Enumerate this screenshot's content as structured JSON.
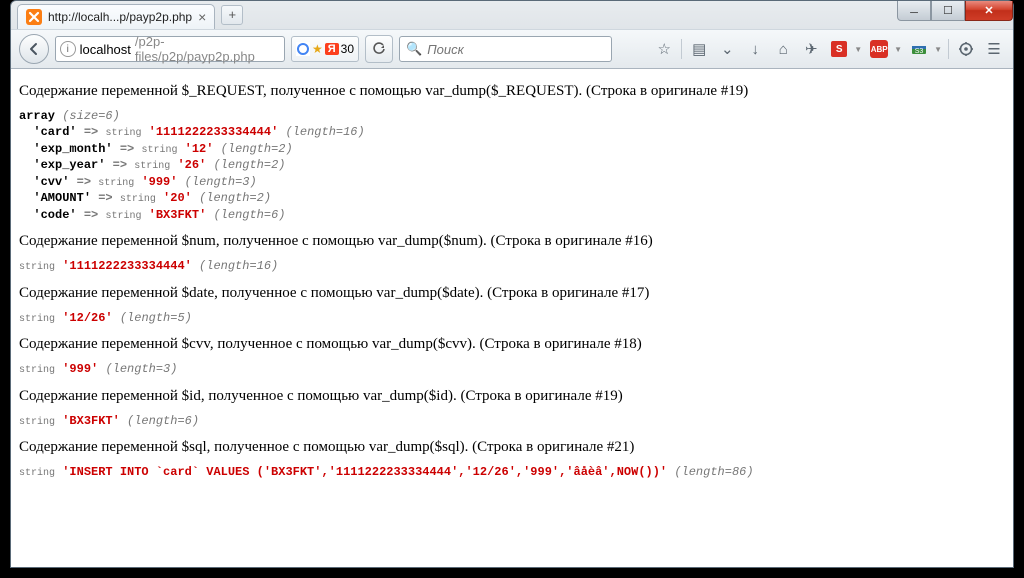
{
  "window": {
    "title": "http://localh...p/payp2p.php",
    "min": "—",
    "max": "▭",
    "close": "X"
  },
  "nav": {
    "url_host": "localhost",
    "url_path": "/p2p-files/p2p/payp2p.php",
    "ya_count": "30",
    "search_placeholder": "Поиск"
  },
  "page": {
    "h_request": "Содержание переменной $_REQUEST, полученное с помощью var_dump($_REQUEST). (Строка в оригинале #19)",
    "h_num": "Содержание переменной $num, полученное с помощью var_dump($num). (Строка в оригинале #16)",
    "h_date": "Содержание переменной $date, полученное с помощью var_dump($date). (Строка в оригинале #17)",
    "h_cvv": "Содержание переменной $cvv, полученное с помощью var_dump($cvv). (Строка в оригинале #18)",
    "h_id": "Содержание переменной $id, полученное с помощью var_dump($id). (Строка в оригинале #19)",
    "h_sql": "Содержание переменной $sql, полученное с помощью var_dump($sql). (Строка в оригинале #21)",
    "request": {
      "size": "(size=6)",
      "items": [
        {
          "key": "'card'",
          "type": "string",
          "val": "'1111222233334444'",
          "len": "(length=16)"
        },
        {
          "key": "'exp_month'",
          "type": "string",
          "val": "'12'",
          "len": "(length=2)"
        },
        {
          "key": "'exp_year'",
          "type": "string",
          "val": "'26'",
          "len": "(length=2)"
        },
        {
          "key": "'cvv'",
          "type": "string",
          "val": "'999'",
          "len": "(length=3)"
        },
        {
          "key": "'AMOUNT'",
          "type": "string",
          "val": "'20'",
          "len": "(length=2)"
        },
        {
          "key": "'code'",
          "type": "string",
          "val": "'BX3FKT'",
          "len": "(length=6)"
        }
      ]
    },
    "num": {
      "type": "string",
      "val": "'1111222233334444'",
      "len": "(length=16)"
    },
    "date": {
      "type": "string",
      "val": "'12/26'",
      "len": "(length=5)"
    },
    "cvv": {
      "type": "string",
      "val": "'999'",
      "len": "(length=3)"
    },
    "id": {
      "type": "string",
      "val": "'BX3FKT'",
      "len": "(length=6)"
    },
    "sql": {
      "type": "string",
      "val": "'INSERT INTO `card` VALUES ('BX3FKT','1111222233334444','12/26','999','âåèâ',NOW())'",
      "len": "(length=86)"
    }
  }
}
